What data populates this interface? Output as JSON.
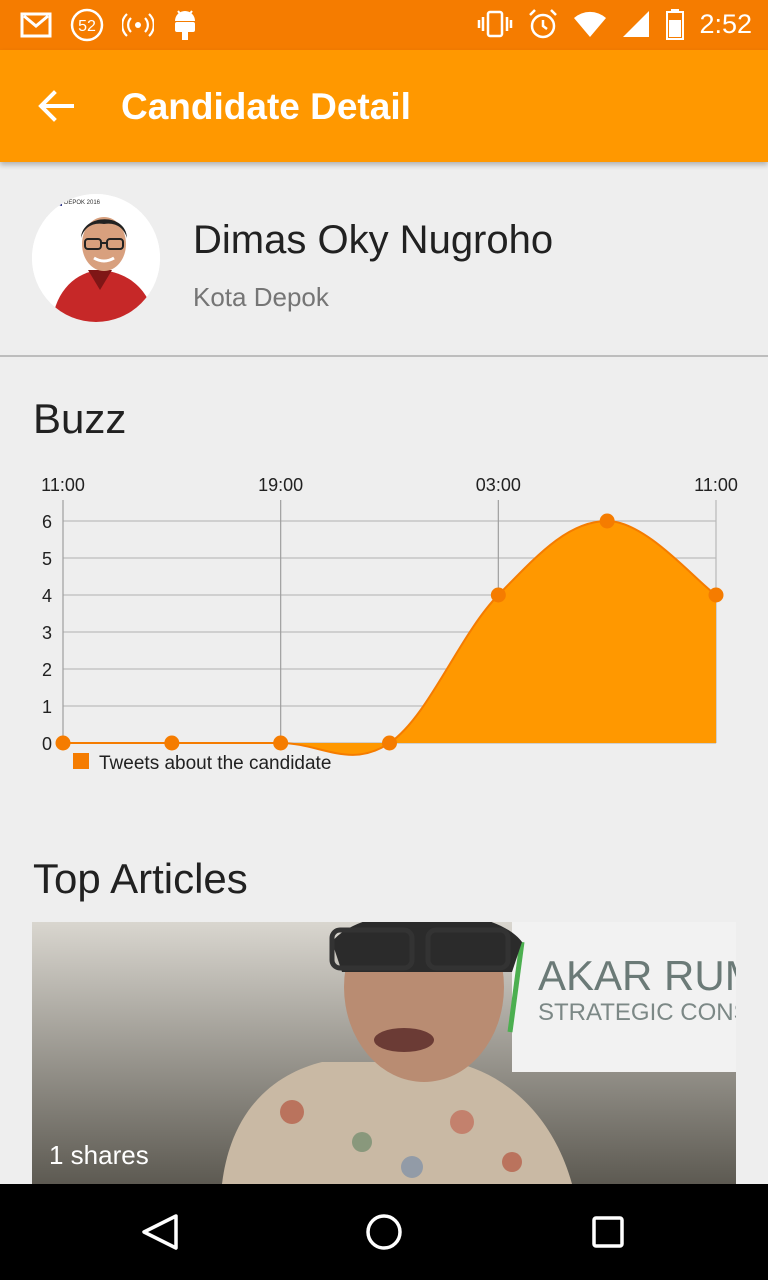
{
  "status_bar": {
    "time": "2:52",
    "notification_count": "52",
    "icons": [
      "gmail-icon",
      "notification-count-icon",
      "wifi-signal-icon",
      "android-icon",
      "vibrate-icon",
      "alarm-icon",
      "wifi-icon",
      "cell-signal-icon",
      "battery-icon"
    ]
  },
  "app_bar": {
    "title": "Candidate Detail",
    "back_icon": "arrow-left-icon",
    "color": "#ff9800"
  },
  "candidate": {
    "name": "Dimas Oky Nugroho",
    "region": "Kota Depok",
    "avatar_text": "DEPOK 2016"
  },
  "buzz": {
    "title": "Buzz"
  },
  "chart_data": {
    "type": "area",
    "x_ticks": [
      "11:00",
      "19:00",
      "03:00",
      "11:00"
    ],
    "x": [
      0,
      1,
      2,
      3,
      4,
      5,
      6
    ],
    "series": [
      {
        "name": "Tweets about the candidate",
        "values": [
          0,
          0,
          0,
          0,
          4,
          6,
          4
        ],
        "color": "#ff9800"
      }
    ],
    "ylim": [
      0,
      6
    ],
    "y_ticks": [
      0,
      1,
      2,
      3,
      4,
      5,
      6
    ],
    "grid": true,
    "legend": "bottom-left"
  },
  "articles": {
    "title": "Top Articles",
    "items": [
      {
        "shares": "1 shares",
        "image_text": "AKAR RUMP STRATEGIC CONSU"
      }
    ]
  },
  "nav_bar": {
    "icons": [
      "back-triangle-icon",
      "home-circle-icon",
      "recents-square-icon"
    ]
  }
}
